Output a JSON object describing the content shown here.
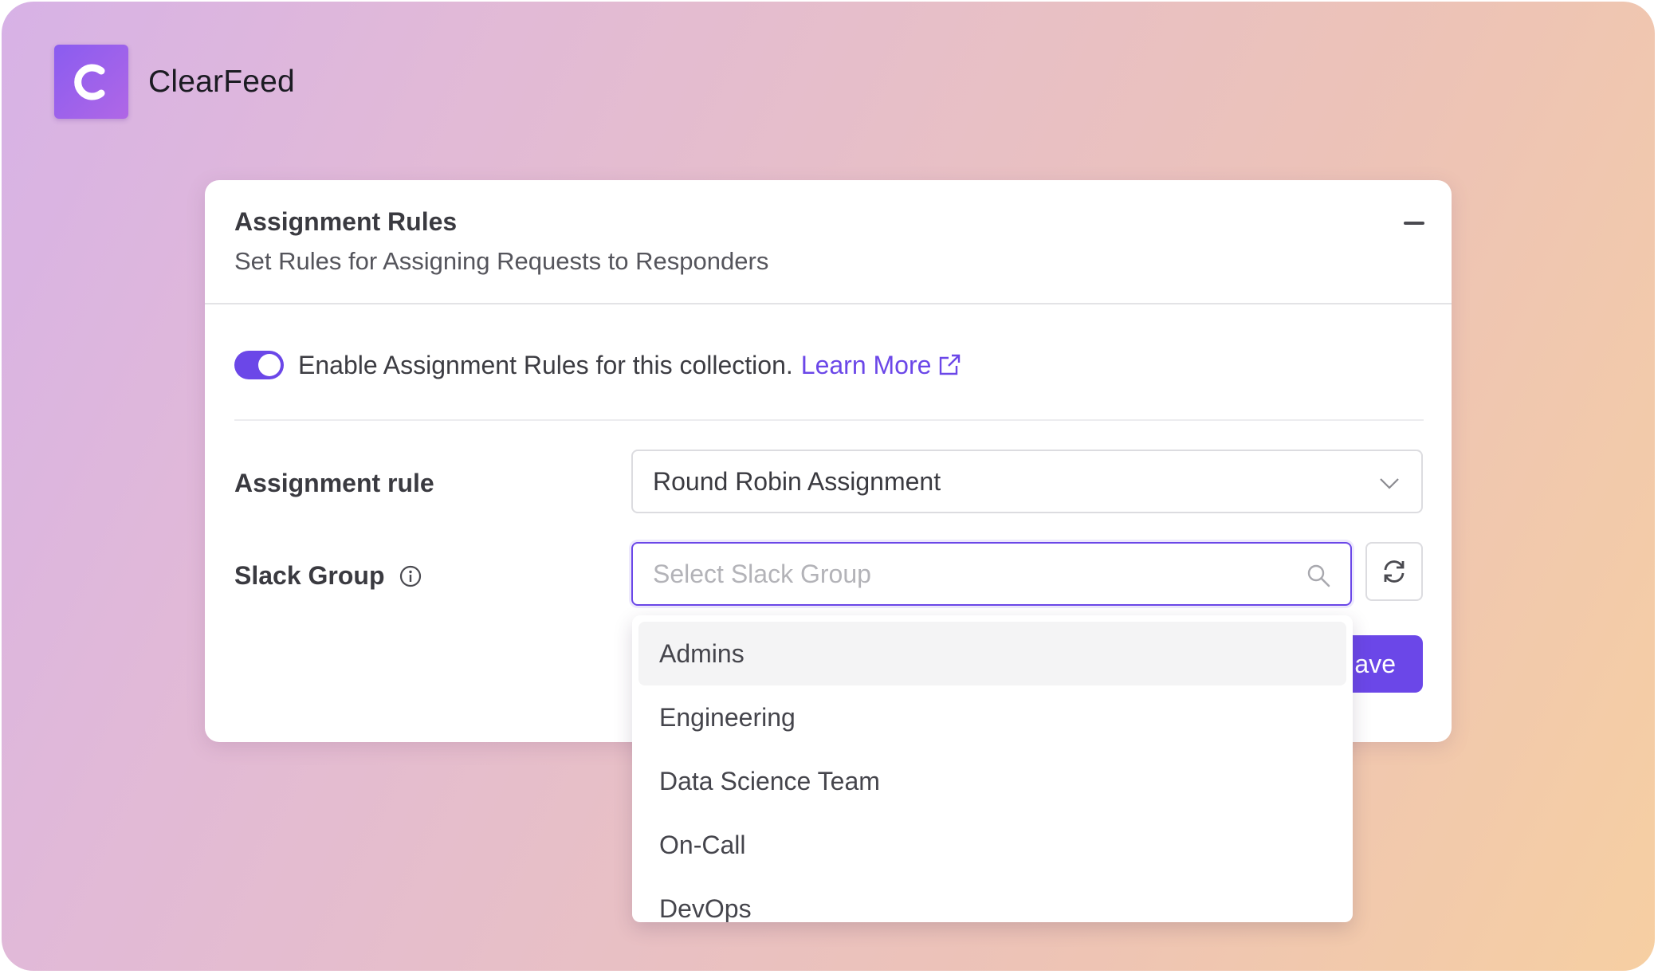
{
  "brand": {
    "name": "ClearFeed",
    "logo_letter": "C",
    "logo_icon": "clearfeed-logo-icon"
  },
  "card": {
    "title": "Assignment Rules",
    "subtitle": "Set Rules for Assigning Requests to Responders",
    "collapse_icon": "minus-icon"
  },
  "toggle": {
    "enabled": true,
    "label": "Enable Assignment Rules for this collection.",
    "link_text": "Learn More",
    "link_icon": "external-link-icon"
  },
  "assignment_rule": {
    "label": "Assignment rule",
    "value": "Round Robin Assignment",
    "icon": "chevron-down-icon"
  },
  "slack_group": {
    "label": "Slack Group",
    "info_icon": "info-icon",
    "placeholder": "Select Slack Group",
    "search_icon": "search-icon",
    "refresh_icon": "refresh-icon",
    "options": [
      "Admins",
      "Engineering",
      "Data Science Team",
      "On-Call",
      "DevOps"
    ],
    "highlighted": "Admins"
  },
  "save": {
    "label": "Save",
    "visible_text": "ave"
  },
  "colors": {
    "accent": "#6b47e8",
    "text": "#3a3a40"
  }
}
